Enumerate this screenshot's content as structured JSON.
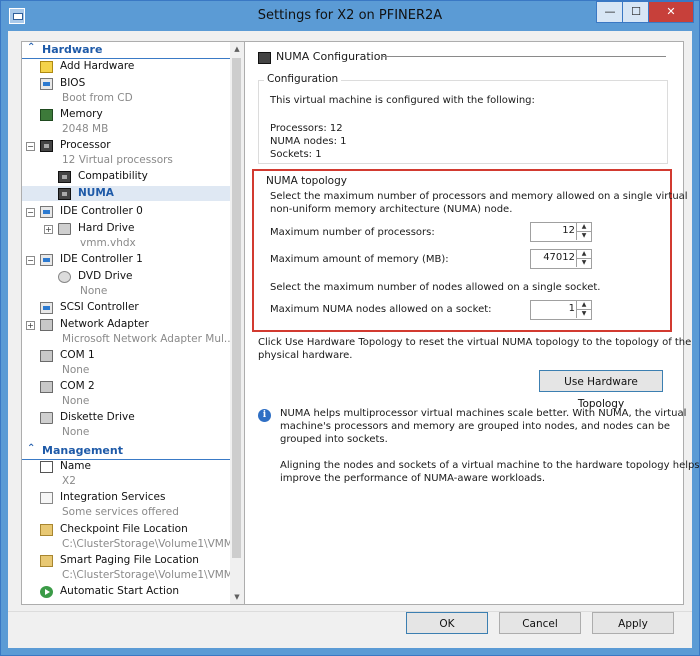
{
  "window": {
    "title": "Settings for X2 on PFINER2A",
    "min": "—",
    "max": "☐",
    "close": "✕"
  },
  "sidebar": {
    "hardware_label": "Hardware",
    "management_label": "Management",
    "hardware_items": [
      {
        "label": "Add Hardware",
        "sub": ""
      },
      {
        "label": "BIOS",
        "sub": "Boot from CD"
      },
      {
        "label": "Memory",
        "sub": "2048 MB"
      },
      {
        "label": "Processor",
        "sub": "12 Virtual processors"
      },
      {
        "label": "Compatibility",
        "sub": ""
      },
      {
        "label": "NUMA",
        "sub": ""
      },
      {
        "label": "IDE Controller 0",
        "sub": ""
      },
      {
        "label": "Hard Drive",
        "sub": "vmm.vhdx"
      },
      {
        "label": "IDE Controller 1",
        "sub": ""
      },
      {
        "label": "DVD Drive",
        "sub": "None"
      },
      {
        "label": "SCSI Controller",
        "sub": ""
      },
      {
        "label": "Network Adapter",
        "sub": "Microsoft Network Adapter Mul..."
      },
      {
        "label": "COM 1",
        "sub": "None"
      },
      {
        "label": "COM 2",
        "sub": "None"
      },
      {
        "label": "Diskette Drive",
        "sub": "None"
      }
    ],
    "management_items": [
      {
        "label": "Name",
        "sub": "X2"
      },
      {
        "label": "Integration Services",
        "sub": "Some services offered"
      },
      {
        "label": "Checkpoint File Location",
        "sub": "C:\\ClusterStorage\\Volume1\\VMM"
      },
      {
        "label": "Smart Paging File Location",
        "sub": "C:\\ClusterStorage\\Volume1\\VMM"
      },
      {
        "label": "Automatic Start Action",
        "sub": ""
      }
    ]
  },
  "panel": {
    "title": "NUMA Configuration",
    "config_group": "Configuration",
    "config_intro": "This virtual machine is configured with the following:",
    "processors": "Processors: 12",
    "numa_nodes": "NUMA nodes: 1",
    "sockets": "Sockets: 1",
    "topology_group": "NUMA topology",
    "topology_desc1": "Select the maximum number of processors and memory allowed on a single virtual",
    "topology_desc2": "non-uniform memory architecture (NUMA) node.",
    "max_proc_label": "Maximum number of processors:",
    "max_proc_value": "12",
    "max_mem_label": "Maximum amount of memory (MB):",
    "max_mem_value": "47012",
    "nodes_desc": "Select the maximum number of nodes allowed on a single socket.",
    "max_nodes_label": "Maximum NUMA nodes allowed on a socket:",
    "max_nodes_value": "1",
    "hw_topology_text1": "Click Use Hardware Topology to reset the virtual NUMA topology to the topology of the",
    "hw_topology_text2": "physical hardware.",
    "hw_topology_button": "Use Hardware Topology",
    "info1_line1": "NUMA helps multiprocessor virtual machines scale better.  With NUMA, the virtual",
    "info1_line2": "machine's processors and memory are grouped into nodes, and nodes can be",
    "info1_line3": "grouped into sockets.",
    "info2_line1": "Aligning the nodes and sockets of a virtual machine to the hardware topology helps",
    "info2_line2": "improve the performance of NUMA-aware workloads."
  },
  "footer": {
    "ok": "OK",
    "cancel": "Cancel",
    "apply": "Apply"
  }
}
